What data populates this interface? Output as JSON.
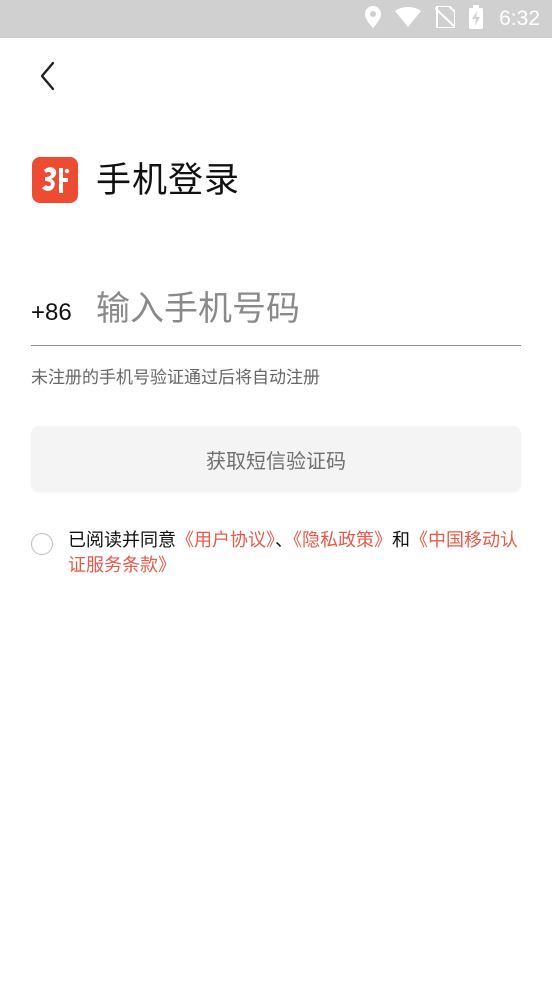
{
  "status_bar": {
    "time": "6:32",
    "icons": [
      "location-icon",
      "wifi-icon",
      "no-sim-icon",
      "battery-charging-icon"
    ]
  },
  "header": {
    "back_icon": "chevron-left-icon",
    "title": "手机登录"
  },
  "logo": {
    "name": "app-logo",
    "color": "#ee4b33"
  },
  "phone": {
    "country_code": "+86",
    "placeholder": "输入手机号码",
    "value": ""
  },
  "hint": "未注册的手机号验证通过后将自动注册",
  "get_code_button": {
    "label": "获取短信验证码"
  },
  "agreement": {
    "prefix": "已阅读并同意",
    "user_agreement": "《用户协议》",
    "separator": "、",
    "privacy_policy": "《隐私政策》",
    "and": "和",
    "cmcc_terms": "《中国移动认证服务条款》"
  },
  "colors": {
    "accent": "#e9594a",
    "logo_bg": "#ee4b33",
    "status_bar_bg": "#d0d0d0",
    "button_bg": "#f4f4f4"
  }
}
